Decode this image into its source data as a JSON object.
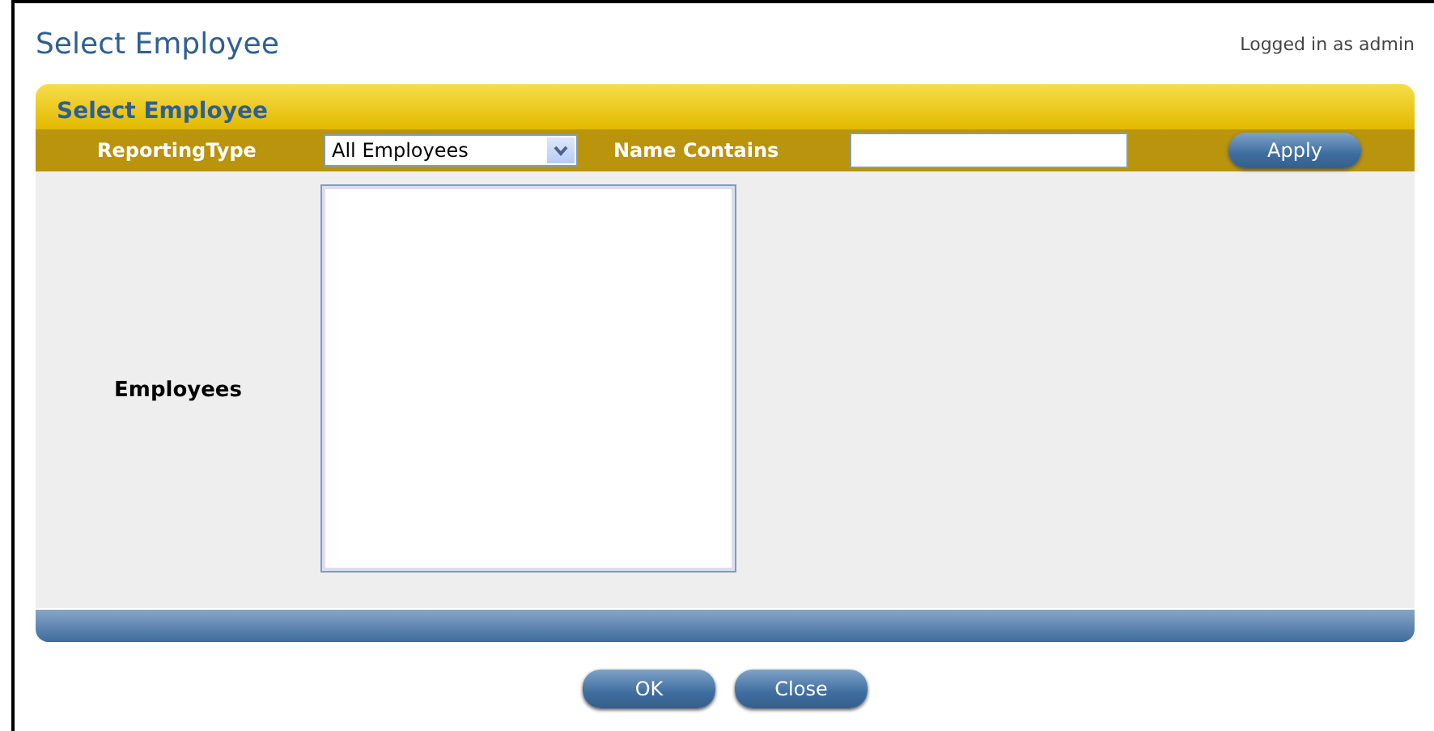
{
  "page": {
    "title": "Select Employee",
    "user_status": "Logged in as admin"
  },
  "panel": {
    "title": "Select Employee",
    "filters": {
      "reporting_type_label": "ReportingType",
      "reporting_type_value": "All Employees",
      "name_label": "Name Contains",
      "apply": "Apply"
    },
    "employees_label": "Employees"
  },
  "buttons": [
    "OK",
    "Close"
  ]
}
